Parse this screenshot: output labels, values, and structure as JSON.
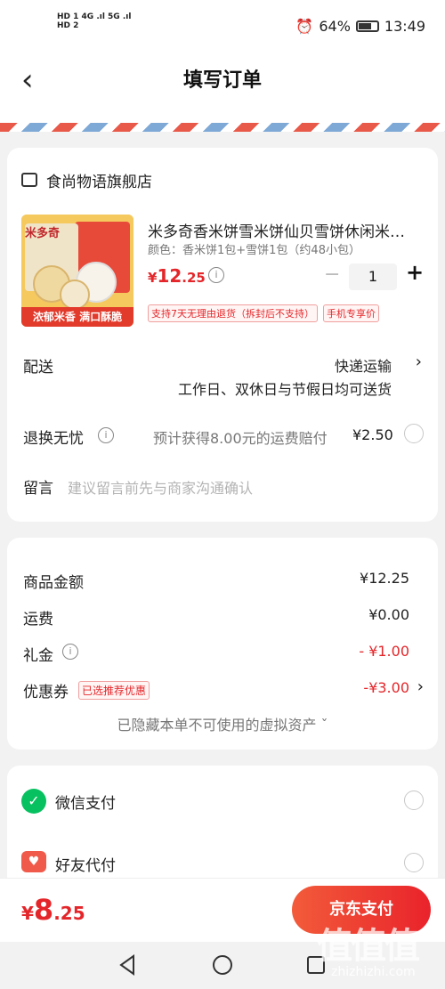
{
  "status_bar": {
    "left_line1": "HD 1  4G .ıl  5G .ıl",
    "left_line2": "HD 2",
    "battery_text": "64%",
    "time": "13:49"
  },
  "header": {
    "title": "填写订单",
    "back_symbol": "‹"
  },
  "shop": {
    "name": "食尚物语旗舰店"
  },
  "product": {
    "title": "米多奇香米饼雪米饼仙贝雪饼休闲米…",
    "spec": "颜色：香米饼1包+雪饼1包（约48小包）",
    "price_currency": "¥",
    "price_int": "12",
    "price_dec": ".25",
    "qty": "1",
    "qty_minus": "−",
    "qty_plus": "+",
    "tags": [
      "支持7天无理由退货（拆封后不支持）",
      "手机专享价"
    ],
    "image_caption": "浓郁米香 满口酥脆",
    "image_brand": "米多奇"
  },
  "delivery": {
    "label": "配送",
    "method": "快递运输",
    "note": "工作日、双休日与节假日均可送货"
  },
  "return": {
    "label": "退换无忧",
    "desc": "预计获得8.00元的运费赔付",
    "price": "¥2.50"
  },
  "message": {
    "label": "留言",
    "placeholder": "建议留言前先与商家沟通确认"
  },
  "summary": {
    "goods_label": "商品金额",
    "goods_val": "¥12.25",
    "shipping_label": "运费",
    "shipping_val": "¥0.00",
    "gift_label": "礼金",
    "gift_val": "- ¥1.00",
    "coupon_label": "优惠券",
    "coupon_tag": "已选推荐优惠",
    "coupon_val": "-¥3.00",
    "hidden_note": "已隐藏本单不可使用的虚拟资产 ˇ"
  },
  "payment": {
    "wechat_label": "微信支付",
    "friend_label": "好友代付"
  },
  "bottom": {
    "total_currency": "¥",
    "total_int": "8",
    "total_dec": ".25",
    "pay_button": "京东支付"
  },
  "watermark": {
    "mark": "值值值",
    "url": "zhizhizhi.com"
  },
  "colors": {
    "accent": "#e4262a",
    "wechat": "#07c160"
  }
}
